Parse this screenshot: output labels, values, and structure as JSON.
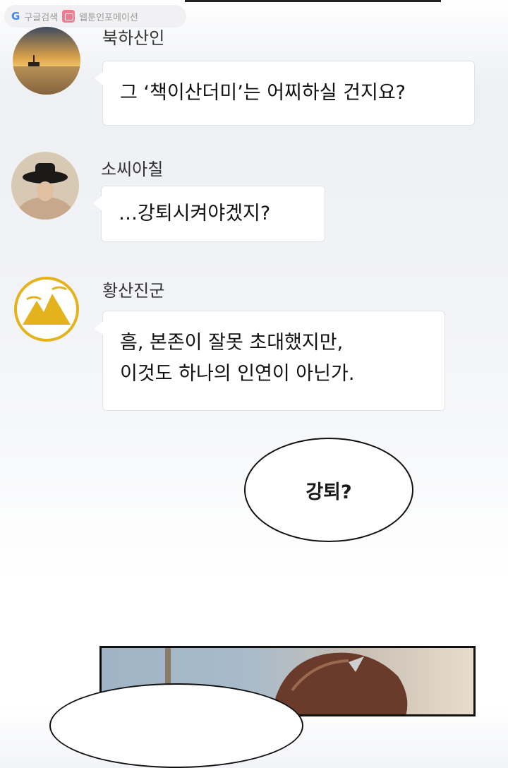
{
  "watermark": {
    "search_label": "구글검색",
    "site_label": "웹툰인포메이션"
  },
  "messages": [
    {
      "name": "북하산인",
      "lines": [
        "그 ‘책이산더미’는 어찌하실 건지요?"
      ]
    },
    {
      "name": "소씨아칠",
      "lines": [
        "…강퇴시켜야겠지?"
      ]
    },
    {
      "name": "황산진군",
      "lines": [
        "흠, 본존이 잘못 초대했지만,",
        "이것도 하나의 인연이 아닌가."
      ]
    }
  ],
  "speech_bubble": {
    "text": "강퇴?"
  },
  "icons": {
    "google": "google-g-icon",
    "webtoon": "webtoon-badge-icon"
  },
  "colors": {
    "bubble_border": "#e0e2e6",
    "emblem_gold": "#e3b21c"
  }
}
